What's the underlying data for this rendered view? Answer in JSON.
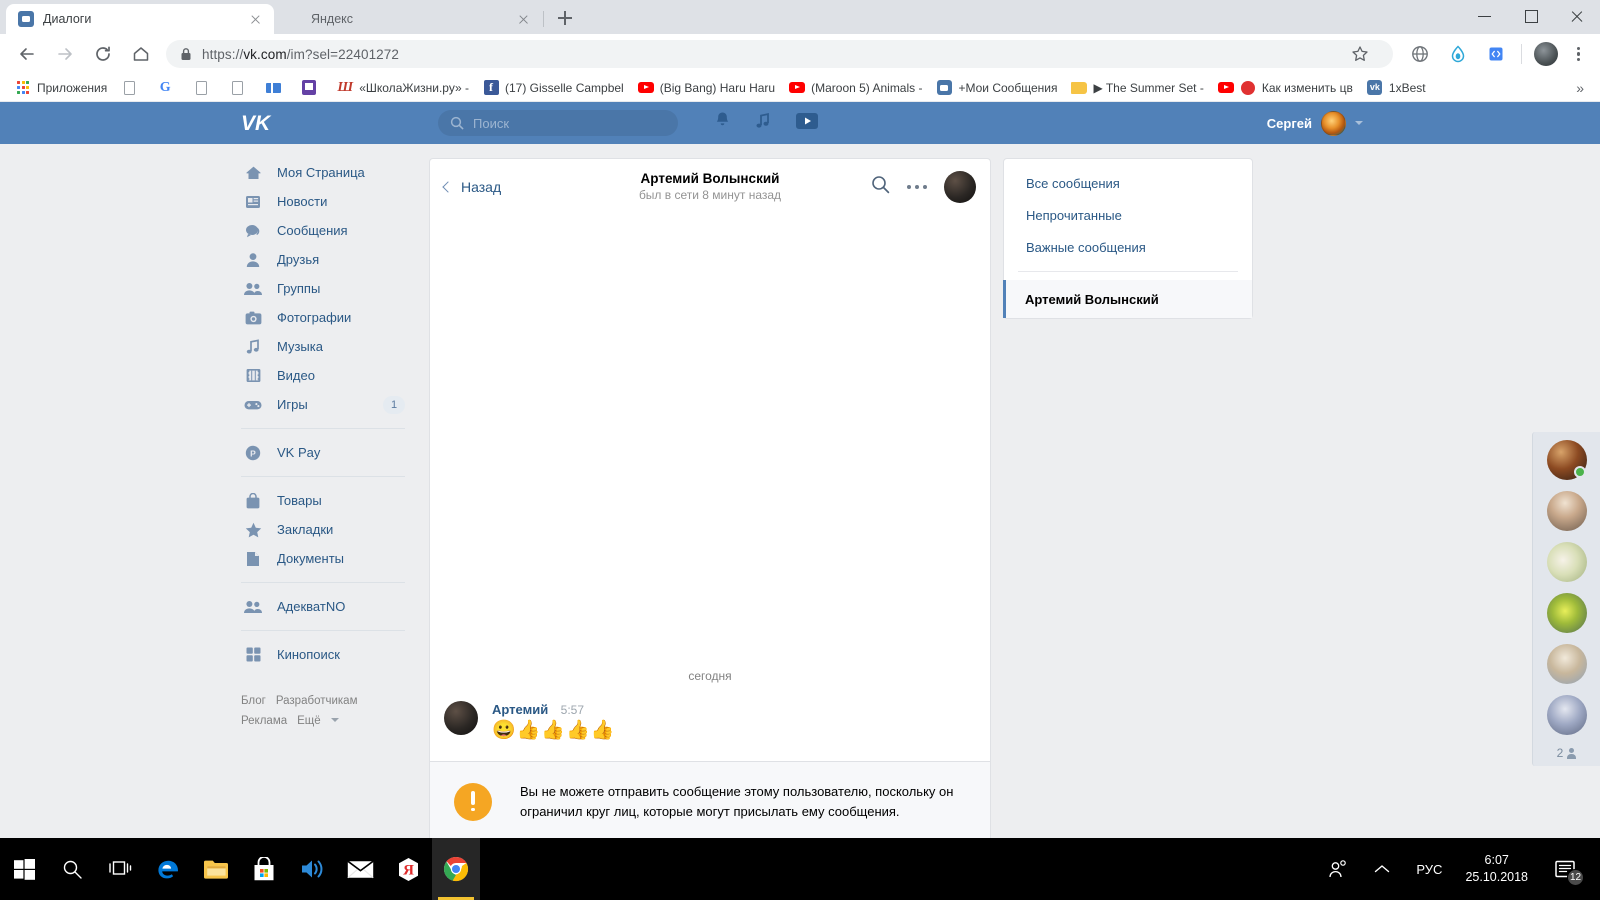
{
  "browser": {
    "tabs": [
      {
        "title": "Диалоги",
        "favicon": "vk-messages-icon",
        "active": true
      },
      {
        "title": "Яндекс",
        "favicon": "blank-page-icon",
        "active": false
      }
    ],
    "new_tab_label": "+",
    "window_controls": {
      "minimize": "minimize-icon",
      "maximize": "maximize-icon",
      "close": "close-icon"
    },
    "url_prefix": "https://",
    "url_domain": "vk.com",
    "url_path": "/im?sel=22401272",
    "url_full": "https://vk.com/im?sel=22401272",
    "bookmarks": [
      {
        "label": "Приложения",
        "icon": "apps-grid-icon"
      },
      {
        "label": "",
        "icon": "document-icon"
      },
      {
        "label": "",
        "icon": "google-icon"
      },
      {
        "label": "",
        "icon": "document-icon"
      },
      {
        "label": "",
        "icon": "document-icon"
      },
      {
        "label": "",
        "icon": "blue-bars-icon"
      },
      {
        "label": "",
        "icon": "twitch-icon"
      },
      {
        "label": "«ШколаЖизни.ру» -",
        "icon": "shkolazhizni-icon"
      },
      {
        "label": "(17) Gisselle Campbel",
        "icon": "facebook-icon"
      },
      {
        "label": "(Big Bang) Haru Haru",
        "icon": "youtube-icon"
      },
      {
        "label": "(Maroon 5) Animals -",
        "icon": "youtube-icon"
      },
      {
        "label": "+Мои Сообщения",
        "icon": "vk-messages-icon"
      },
      {
        "label": "▶ The Summer Set -",
        "icon": "folder-icon"
      },
      {
        "label": "Как изменить цв",
        "icon": "youtube-red-dot-icon"
      },
      {
        "label": "1xBest",
        "icon": "vk-icon"
      }
    ],
    "bookmarks_overflow": "»"
  },
  "vk": {
    "logo": "vk-logo",
    "search": {
      "placeholder": "Поиск",
      "icon": "search-icon"
    },
    "top_icons": [
      "bell-icon",
      "music-note-icon",
      "video-play-icon"
    ],
    "user": {
      "name": "Сергей",
      "avatar": "user-avatar",
      "chevron": "chevron-down-icon"
    },
    "nav": [
      {
        "label": "Моя Страница",
        "icon": "home-icon",
        "badge": ""
      },
      {
        "label": "Новости",
        "icon": "news-icon",
        "badge": ""
      },
      {
        "label": "Сообщения",
        "icon": "chat-bubble-icon",
        "badge": ""
      },
      {
        "label": "Друзья",
        "icon": "person-icon",
        "badge": ""
      },
      {
        "label": "Группы",
        "icon": "people-icon",
        "badge": ""
      },
      {
        "label": "Фотографии",
        "icon": "camera-icon",
        "badge": ""
      },
      {
        "label": "Музыка",
        "icon": "music-note-icon",
        "badge": ""
      },
      {
        "label": "Видео",
        "icon": "film-icon",
        "badge": ""
      },
      {
        "label": "Игры",
        "icon": "gamepad-icon",
        "badge": "1"
      },
      {
        "label": "VK Pay",
        "icon": "vkpay-icon",
        "badge": ""
      },
      {
        "label": "Товары",
        "icon": "bag-icon",
        "badge": ""
      },
      {
        "label": "Закладки",
        "icon": "star-icon",
        "badge": ""
      },
      {
        "label": "Документы",
        "icon": "document-icon",
        "badge": ""
      },
      {
        "label": "АдекватNO",
        "icon": "people-icon",
        "badge": ""
      },
      {
        "label": "Кинопоиск",
        "icon": "squares-icon",
        "badge": ""
      }
    ],
    "footer_links": [
      "Блог",
      "Разработчикам",
      "Реклама",
      "Ещё"
    ],
    "footer_more_chevron": "chevron-down-icon",
    "chat": {
      "back_label": "Назад",
      "title": "Артемий Волынский",
      "subtitle": "был в сети 8 минут назад",
      "search_icon": "search-icon",
      "more_icon": "more-dots-icon",
      "peer_avatar": "peer-avatar",
      "day_separator": "сегодня",
      "message": {
        "author": "Артемий",
        "time": "5:57",
        "text": "😀👍👍👍👍"
      },
      "warning": {
        "icon": "warning-exclamation-icon",
        "text": "Вы не можете отправить сообщение этому пользователю, поскольку он ограничил круг лиц, которые могут присылать ему сообщения."
      }
    },
    "im_list": {
      "filters": [
        "Все сообщения",
        "Непрочитанные",
        "Важные сообщения"
      ],
      "conversations": [
        {
          "name": "Артемий Волынский",
          "selected": true
        }
      ]
    },
    "friends_strip": {
      "avatars": [
        {
          "name": "friend-avatar-1",
          "online": true
        },
        {
          "name": "friend-avatar-2",
          "online": false
        },
        {
          "name": "friend-avatar-3",
          "online": false
        },
        {
          "name": "friend-avatar-4",
          "online": false
        },
        {
          "name": "friend-avatar-5",
          "online": false
        },
        {
          "name": "friend-avatar-6",
          "online": false
        }
      ],
      "count": "2",
      "count_icon": "person-icon"
    }
  },
  "taskbar": {
    "items": [
      {
        "name": "start-button",
        "icon": "windows-logo-icon"
      },
      {
        "name": "search-button",
        "icon": "search-icon"
      },
      {
        "name": "task-view-button",
        "icon": "task-view-icon"
      },
      {
        "name": "edge-button",
        "icon": "edge-icon"
      },
      {
        "name": "file-explorer-button",
        "icon": "folder-icon"
      },
      {
        "name": "microsoft-store-button",
        "icon": "store-icon"
      },
      {
        "name": "groove-music-button",
        "icon": "speaker-icon"
      },
      {
        "name": "mail-button",
        "icon": "mail-icon"
      },
      {
        "name": "yandex-browser-button",
        "icon": "yandex-icon"
      },
      {
        "name": "chrome-button",
        "icon": "chrome-icon"
      }
    ],
    "tray": {
      "people_icon": "people-share-icon",
      "chevron_icon": "chevron-up-icon",
      "language": "РУС",
      "time": "6:07",
      "date": "25.10.2018",
      "notification_icon": "notification-icon",
      "notification_count": "12"
    }
  },
  "colors": {
    "vk_blue": "#5181b8",
    "vk_link": "#2a5885",
    "page_bg": "#edeef0",
    "warning_orange": "#f5a623",
    "online_green": "#4bb34b",
    "taskbar_accent": "#f2c230"
  }
}
